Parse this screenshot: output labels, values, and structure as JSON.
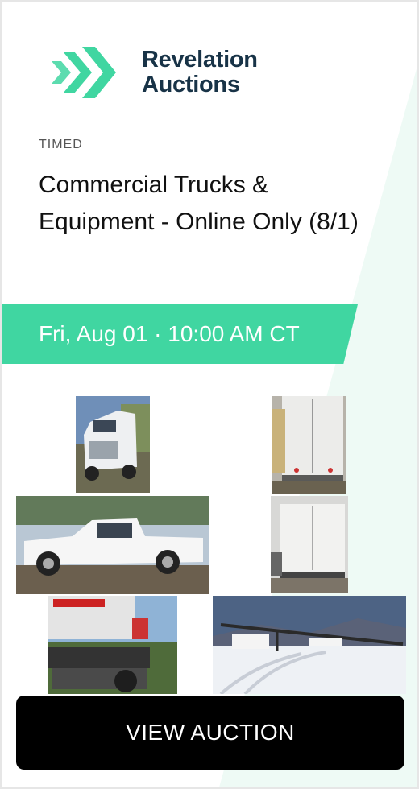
{
  "brand": {
    "name_line1": "Revelation",
    "name_line2": "Auctions",
    "accent_color": "#40d6a1",
    "text_color": "#183347"
  },
  "auction": {
    "type": "TIMED",
    "title": "Commercial Trucks & Equipment - Online Only (8/1)",
    "date": "Fri, Aug 01 · 10:00 AM CT"
  },
  "gallery": [
    {
      "subject": "white semi truck tractor"
    },
    {
      "subject": "rear of box trailer"
    },
    {
      "subject": "white pickup truck"
    },
    {
      "subject": "white box trailer"
    },
    {
      "subject": "flatbed truck with toolboxes"
    },
    {
      "subject": "car hauler trailer in snow"
    }
  ],
  "cta": {
    "label": "VIEW AUCTION"
  }
}
